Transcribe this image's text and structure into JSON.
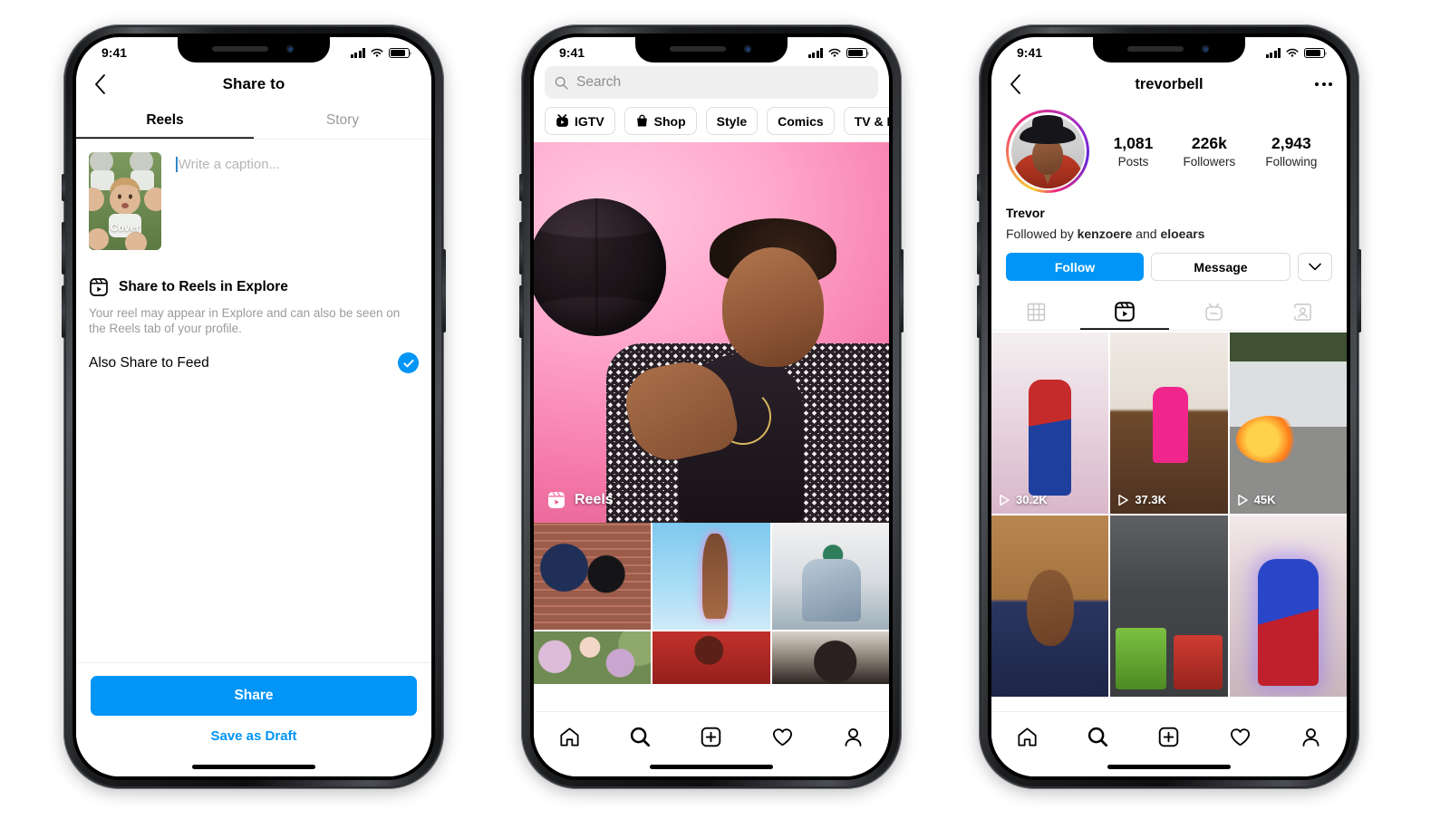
{
  "page": {
    "background": "#ffffff",
    "accent": "#0095f6"
  },
  "status": {
    "time": "9:41",
    "signal_icon": "cellular-bars-icon",
    "wifi_icon": "wifi-icon",
    "battery_icon": "battery-full-icon"
  },
  "phone1": {
    "nav": {
      "back_icon": "chevron-left-icon",
      "title": "Share to"
    },
    "tabs": [
      {
        "label": "Reels",
        "active": true
      },
      {
        "label": "Story",
        "active": false
      }
    ],
    "cover": {
      "label": "Cover",
      "name": "cover-thumbnail"
    },
    "caption": {
      "placeholder": "Write a caption...",
      "value": ""
    },
    "explore": {
      "icon": "reels-icon",
      "title": "Share to Reels in Explore",
      "description": "Your reel may appear in Explore and can also be seen on the Reels tab of your profile."
    },
    "also_share": {
      "label": "Also Share to Feed",
      "checked": true,
      "check_icon": "check-circle-icon"
    },
    "footer": {
      "primary": "Share",
      "secondary": "Save as Draft"
    }
  },
  "phone2": {
    "search": {
      "placeholder": "Search",
      "value": "",
      "icon": "search-icon"
    },
    "chips": [
      {
        "label": "IGTV",
        "icon": "igtv-icon"
      },
      {
        "label": "Shop",
        "icon": "shopping-bag-icon"
      },
      {
        "label": "Style",
        "icon": ""
      },
      {
        "label": "Comics",
        "icon": ""
      },
      {
        "label": "TV & Movies",
        "icon": ""
      }
    ],
    "hero": {
      "badge": "Reels",
      "badge_icon": "reels-icon",
      "alt": "person-spinning-basketball"
    },
    "grid": [
      {
        "name": "tile-brick-couple"
      },
      {
        "name": "tile-glitter-hand"
      },
      {
        "name": "tile-denim-outfit"
      },
      {
        "name": "tile-flowers"
      },
      {
        "name": "tile-red-hoodie"
      },
      {
        "name": "tile-dark-portrait"
      }
    ],
    "tabbar": [
      {
        "icon": "home-icon",
        "active": false
      },
      {
        "icon": "search-icon",
        "active": true
      },
      {
        "icon": "plus-square-icon",
        "active": false
      },
      {
        "icon": "heart-icon",
        "active": false
      },
      {
        "icon": "person-icon",
        "active": false
      }
    ]
  },
  "phone3": {
    "nav": {
      "back_icon": "chevron-left-icon",
      "title": "trevorbell",
      "more_icon": "more-horizontal-icon"
    },
    "avatar": {
      "name": "avatar",
      "has_story_ring": true
    },
    "stats": [
      {
        "number": "1,081",
        "label": "Posts"
      },
      {
        "number": "226k",
        "label": "Followers"
      },
      {
        "number": "2,943",
        "label": "Following"
      }
    ],
    "display_name": "Trevor",
    "followed_by": {
      "prefix": "Followed by ",
      "first": "kenzoere",
      "middle": " and ",
      "second": "eloears"
    },
    "actions": {
      "follow": "Follow",
      "message": "Message",
      "caret_icon": "chevron-down-icon"
    },
    "tabs": [
      {
        "icon": "grid-icon",
        "active": false
      },
      {
        "icon": "reels-icon",
        "active": true
      },
      {
        "icon": "igtv-icon",
        "active": false
      },
      {
        "icon": "tagged-person-icon",
        "active": false
      }
    ],
    "grid": [
      {
        "views": "30.2K",
        "play_icon": "play-icon",
        "name": "reel-spiderman"
      },
      {
        "views": "37.3K",
        "play_icon": "play-icon",
        "name": "reel-workout"
      },
      {
        "views": "45K",
        "play_icon": "play-icon",
        "name": "reel-bus-fire"
      },
      {
        "views": "",
        "play_icon": "",
        "name": "reel-talking-head"
      },
      {
        "views": "",
        "play_icon": "",
        "name": "reel-box-jump"
      },
      {
        "views": "",
        "play_icon": "",
        "name": "reel-superhero"
      }
    ],
    "tabbar": [
      {
        "icon": "home-icon",
        "active": false
      },
      {
        "icon": "search-icon",
        "active": true
      },
      {
        "icon": "plus-square-icon",
        "active": false
      },
      {
        "icon": "heart-icon",
        "active": false
      },
      {
        "icon": "person-icon",
        "active": false
      }
    ]
  }
}
